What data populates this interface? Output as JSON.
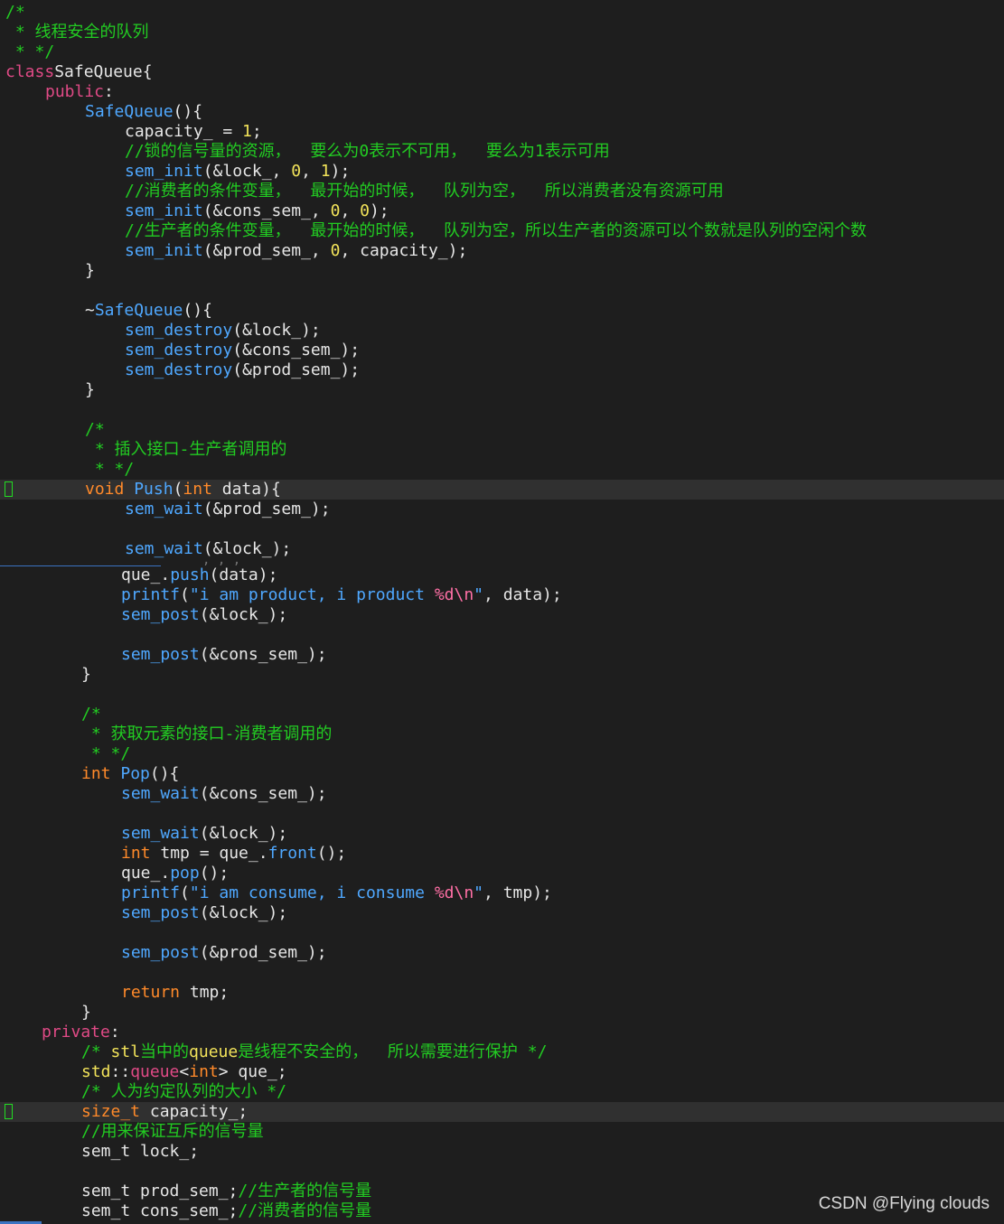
{
  "colors": {
    "background": "#1e1e1e",
    "comment": "#22cc22",
    "keyword": "#e04a86",
    "type": "#ff8a2a",
    "function": "#4fa8ff",
    "number": "#f2e35a",
    "default_text": "#e6e6e6",
    "cursor_line": "#303030"
  },
  "watermark": "CSDN @Flying  clouds",
  "lines": [
    [
      [
        "cmt",
        "/*"
      ]
    ],
    [
      [
        "cmt",
        " * 线程安全的队列"
      ]
    ],
    [
      [
        "cmt",
        " * */"
      ]
    ],
    [
      [
        "kw",
        "class"
      ],
      [
        "",
        "SafeQueue{"
      ]
    ],
    [
      [
        "kw",
        "public"
      ],
      [
        "",
        ":"
      ]
    ],
    [
      [
        "fn",
        "SafeQueue"
      ],
      [
        "",
        "(){"
      ]
    ],
    [
      [
        "",
        "capacity_ = "
      ],
      [
        "num",
        "1"
      ],
      [
        "",
        ";"
      ]
    ],
    [
      [
        "cmt",
        "//锁的信号量的资源，  要么为0表示不可用，  要么为1表示可用"
      ]
    ],
    [
      [
        "fn",
        "sem_init"
      ],
      [
        "",
        "(&lock_, "
      ],
      [
        "num",
        "0"
      ],
      [
        "",
        ", "
      ],
      [
        "num",
        "1"
      ],
      [
        "",
        ");"
      ]
    ],
    [
      [
        "cmt",
        "//消费者的条件变量，  最开始的时候，  队列为空，  所以消费者没有资源可用"
      ]
    ],
    [
      [
        "fn",
        "sem_init"
      ],
      [
        "",
        "(&cons_sem_, "
      ],
      [
        "num",
        "0"
      ],
      [
        "",
        ", "
      ],
      [
        "num",
        "0"
      ],
      [
        "",
        ");"
      ]
    ],
    [
      [
        "cmt",
        "//生产者的条件变量，  最开始的时候，  队列为空，所以生产者的资源可以个数就是队列的空闲个数"
      ]
    ],
    [
      [
        "fn",
        "sem_init"
      ],
      [
        "",
        "(&prod_sem_, "
      ],
      [
        "num",
        "0"
      ],
      [
        "",
        ", capacity_);"
      ]
    ],
    [
      [
        "",
        "}"
      ]
    ],
    [],
    [
      [
        "",
        "~"
      ],
      [
        "fn",
        "SafeQueue"
      ],
      [
        "",
        "(){"
      ]
    ],
    [
      [
        "fn",
        "sem_destroy"
      ],
      [
        "",
        "(&lock_);"
      ]
    ],
    [
      [
        "fn",
        "sem_destroy"
      ],
      [
        "",
        "(&cons_sem_);"
      ]
    ],
    [
      [
        "fn",
        "sem_destroy"
      ],
      [
        "",
        "(&prod_sem_);"
      ]
    ],
    [
      [
        "",
        "}"
      ]
    ],
    [],
    [
      [
        "cmt",
        "/*"
      ]
    ],
    [
      [
        "cmt",
        " * 插入接口-生产者调用的"
      ]
    ],
    [
      [
        "cmt",
        " * */"
      ]
    ],
    [
      [
        "typ",
        "void"
      ],
      [
        "",
        " "
      ],
      [
        "fn",
        "Push"
      ],
      [
        "",
        "("
      ],
      [
        "typ",
        "int"
      ],
      [
        "",
        " data){"
      ]
    ],
    [
      [
        "fn",
        "sem_wait"
      ],
      [
        "",
        "(&prod_sem_);"
      ]
    ],
    [],
    [
      [
        "fn",
        "sem_wait"
      ],
      [
        "",
        "(&lock_);"
      ]
    ],
    [
      [
        "",
        "que_."
      ],
      [
        "fn",
        "push"
      ],
      [
        "",
        "(data);"
      ]
    ],
    [
      [
        "fn",
        "printf"
      ],
      [
        "",
        "("
      ],
      [
        "str",
        "\"i am product, i product "
      ],
      [
        "esc",
        "%d\\n"
      ],
      [
        "str",
        "\""
      ],
      [
        "",
        ", data);"
      ]
    ],
    [
      [
        "fn",
        "sem_post"
      ],
      [
        "",
        "(&lock_);"
      ]
    ],
    [],
    [
      [
        "fn",
        "sem_post"
      ],
      [
        "",
        "(&cons_sem_);"
      ]
    ],
    [
      [
        "",
        "}"
      ]
    ],
    [],
    [
      [
        "cmt",
        "/*"
      ]
    ],
    [
      [
        "cmt",
        " * 获取元素的接口-消费者调用的"
      ]
    ],
    [
      [
        "cmt",
        " * */"
      ]
    ],
    [
      [
        "typ",
        "int"
      ],
      [
        "",
        " "
      ],
      [
        "fn",
        "Pop"
      ],
      [
        "",
        "(){"
      ]
    ],
    [
      [
        "fn",
        "sem_wait"
      ],
      [
        "",
        "(&cons_sem_);"
      ]
    ],
    [],
    [
      [
        "fn",
        "sem_wait"
      ],
      [
        "",
        "(&lock_);"
      ]
    ],
    [
      [
        "typ",
        "int"
      ],
      [
        "",
        " tmp = que_."
      ],
      [
        "fn",
        "front"
      ],
      [
        "",
        "();"
      ]
    ],
    [
      [
        "",
        "que_."
      ],
      [
        "fn",
        "pop"
      ],
      [
        "",
        "();"
      ]
    ],
    [
      [
        "fn",
        "printf"
      ],
      [
        "",
        "("
      ],
      [
        "str",
        "\"i am consume, i consume "
      ],
      [
        "esc",
        "%d\\n"
      ],
      [
        "str",
        "\""
      ],
      [
        "",
        ", tmp);"
      ]
    ],
    [
      [
        "fn",
        "sem_post"
      ],
      [
        "",
        "(&lock_);"
      ]
    ],
    [],
    [
      [
        "fn",
        "sem_post"
      ],
      [
        "",
        "(&prod_sem_);"
      ]
    ],
    [],
    [
      [
        "typ",
        "return"
      ],
      [
        "",
        " tmp;"
      ]
    ],
    [
      [
        "",
        "}"
      ]
    ],
    [
      [
        "kw",
        "private"
      ],
      [
        "",
        ":"
      ]
    ],
    [
      [
        "cmt",
        "/* "
      ],
      [
        "std",
        "stl"
      ],
      [
        "cmt",
        "当中的"
      ],
      [
        "std",
        "queue"
      ],
      [
        "cmt",
        "是线程不安全的，  所以需要进行保护 */"
      ]
    ],
    [
      [
        "std",
        "std"
      ],
      [
        "",
        "::"
      ],
      [
        "acc",
        "queue"
      ],
      [
        "",
        "<"
      ],
      [
        "typ",
        "int"
      ],
      [
        "",
        "> que_;"
      ]
    ],
    [
      [
        "cmt",
        "/* 人为约定队列的大小 */"
      ]
    ],
    [
      [
        "typ",
        "size_t"
      ],
      [
        "",
        " capacity_;"
      ]
    ],
    [
      [
        "cmt",
        "//用来保证互斥的信号量"
      ]
    ],
    [
      [
        "",
        "sem_t lock_;"
      ]
    ],
    [],
    [
      [
        "",
        "sem_t prod_sem_;"
      ],
      [
        "cmt",
        "//生产者的信号量"
      ]
    ],
    [
      [
        "",
        "sem_t cons_sem_;"
      ],
      [
        "cmt",
        "//消费者的信号量"
      ]
    ]
  ]
}
